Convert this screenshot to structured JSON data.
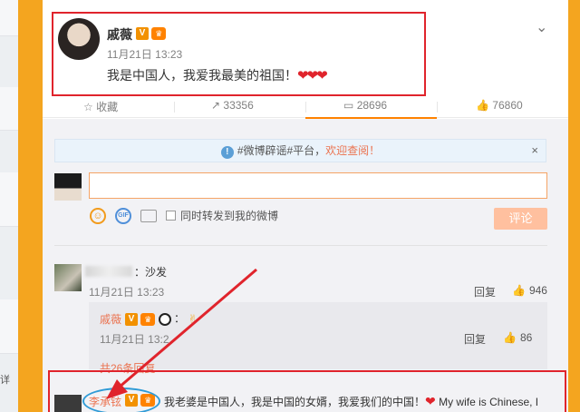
{
  "left": {
    "bottom_text": "详"
  },
  "post": {
    "author": "戚薇",
    "badge_v": "V",
    "badge_crown": "♛",
    "time": "11月21日 13:23",
    "text": "我是中国人，我爱我最美的祖国！",
    "hearts": "❤❤❤",
    "chevron": "⌄"
  },
  "actions": {
    "favorite": {
      "icon": "☆",
      "label": "收藏"
    },
    "repost": {
      "icon": "↗",
      "label": "33356"
    },
    "comment": {
      "icon": "▭",
      "label": "28696"
    },
    "like": {
      "icon": "👍",
      "label": "76860"
    }
  },
  "notice": {
    "icon": "!",
    "prefix": "#微博辟谣#平台，",
    "link": "欢迎查阅！",
    "close": "×"
  },
  "composer": {
    "input_value": "",
    "emoji_icon": "☺",
    "gif_icon": "GIF",
    "checkbox_label": "同时转发到我的微博",
    "submit": "评论"
  },
  "comments": [
    {
      "text": "：沙发",
      "time": "11月21日 13:23",
      "reply_label": "回复",
      "likes": "946",
      "reply": {
        "name": "戚薇",
        "colon": "：",
        "emoji": "✌",
        "time": "11月21日 13:2",
        "reply_label": "回复",
        "likes": "86",
        "more": "共26条回复"
      }
    },
    {
      "name": "李承铉",
      "text": "我老婆是中国人，我是中国的女婿，我爱我们的中国！",
      "heart": "❤",
      "text_en": "My wife is Chinese, I"
    }
  ],
  "colors": {
    "accent_orange": "#ff8200",
    "link_orange": "#eb7350",
    "annotation_red": "#e0242c",
    "annotation_blue": "#2f9bd6",
    "page_bg": "#f4a51f"
  }
}
